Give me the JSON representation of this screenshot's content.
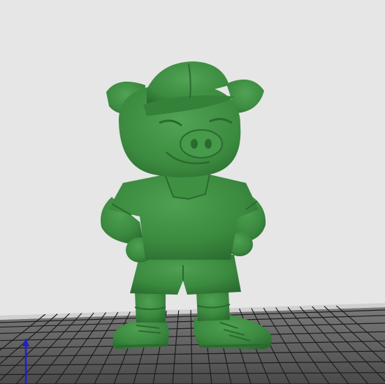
{
  "viewport": {
    "background_color": "#e6e6e6",
    "build_plate": {
      "surface_color": "#5a5a5a",
      "grid_line_color": "#1c1c1c",
      "edge_color": "#cfcfcf"
    },
    "axis_indicator": {
      "icon": "z-axis-arrow-icon",
      "color": "#1f1fd0"
    },
    "model": {
      "subject": "pig-mascot-figurine",
      "color": "#3b8a3f",
      "shade_color": "#2c6e31",
      "highlight_color": "#57a85a"
    }
  }
}
